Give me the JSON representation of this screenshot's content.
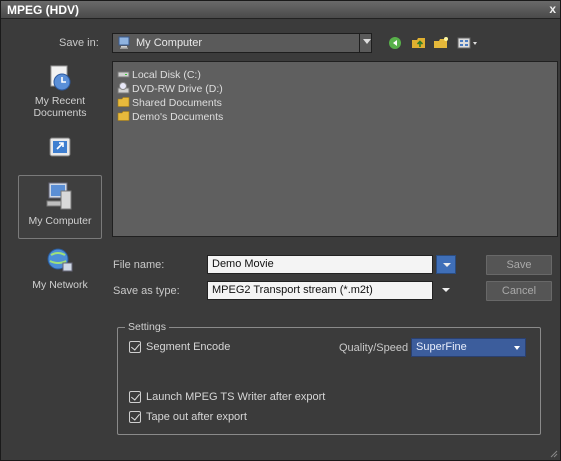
{
  "window": {
    "title": "MPEG (HDV)",
    "close_glyph": "x"
  },
  "save_in": {
    "label": "Save in:",
    "value": "My Computer",
    "icon": "computer-icon"
  },
  "toolbar": {
    "icons": [
      "back-icon",
      "up-folder-icon",
      "new-folder-icon",
      "view-menu-icon"
    ]
  },
  "places": [
    {
      "label": "My Recent Documents",
      "icon": "recent-documents-icon"
    },
    {
      "label": "",
      "icon": "desktop-icon"
    },
    {
      "label": "My Computer",
      "icon": "my-computer-icon",
      "selected": true
    },
    {
      "label": "My Network",
      "icon": "my-network-icon"
    }
  ],
  "files": [
    {
      "name": "Local Disk (C:)",
      "icon": "disk-drive-icon"
    },
    {
      "name": "DVD-RW Drive (D:)",
      "icon": "dvd-drive-icon"
    },
    {
      "name": "Shared Documents",
      "icon": "folder-icon"
    },
    {
      "name": "Demo's Documents",
      "icon": "folder-icon"
    }
  ],
  "file_name": {
    "label": "File name:",
    "value": "Demo Movie"
  },
  "save_as_type": {
    "label": "Save as type:",
    "value": "MPEG2 Transport stream (*.m2t)"
  },
  "buttons": {
    "save": "Save",
    "cancel": "Cancel"
  },
  "settings": {
    "title": "Settings",
    "segment_encode": {
      "label": "Segment Encode",
      "checked": true
    },
    "quality_speed": {
      "label": "Quality/Speed",
      "value": "SuperFine"
    },
    "launch_writer": {
      "label": "Launch MPEG TS Writer after export",
      "checked": true
    },
    "tape_out": {
      "label": "Tape out after export",
      "checked": true
    }
  },
  "colors": {
    "accent": "#3c5d9c",
    "background": "#3b3b3b"
  }
}
